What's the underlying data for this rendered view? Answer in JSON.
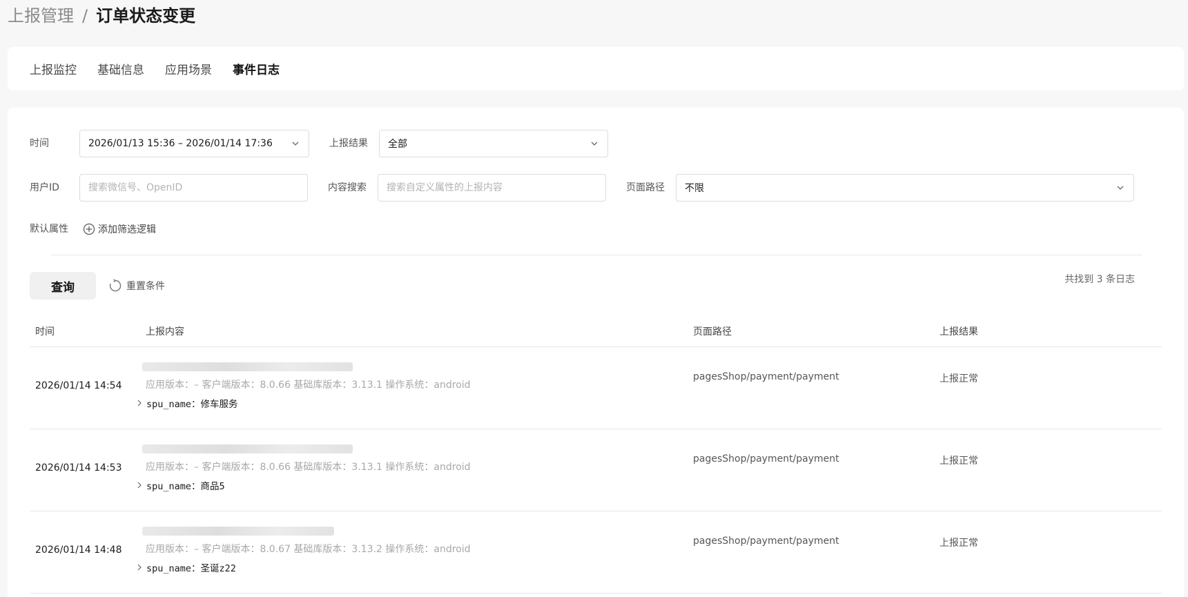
{
  "breadcrumb": {
    "parent": "上报管理",
    "separator": "/",
    "current": "订单状态变更"
  },
  "tabs": [
    {
      "label": "上报监控",
      "active": false
    },
    {
      "label": "基础信息",
      "active": false
    },
    {
      "label": "应用场景",
      "active": false
    },
    {
      "label": "事件日志",
      "active": true
    }
  ],
  "filters": {
    "time": {
      "label": "时间",
      "value": "2026/01/13 15:36 – 2026/01/14 17:36"
    },
    "result": {
      "label": "上报结果",
      "value": "全部"
    },
    "user_id": {
      "label": "用户ID",
      "placeholder": "搜索微信号、OpenID"
    },
    "content": {
      "label": "内容搜索",
      "placeholder": "搜索自定义属性的上报内容"
    },
    "page_path": {
      "label": "页面路径",
      "value": "不限"
    },
    "default_attr": {
      "label": "默认属性"
    },
    "add_filter": "添加筛选逻辑"
  },
  "actions": {
    "query": "查询",
    "reset": "重置条件",
    "count": "共找到 3 条日志"
  },
  "table": {
    "headers": {
      "time": "时间",
      "content": "上报内容",
      "path": "页面路径",
      "result": "上报结果"
    },
    "rows": [
      {
        "time": "2026/01/14 14:54",
        "meta": "应用版本：– 客户端版本：8.0.66 基础库版本：3.13.1 操作系统：android",
        "prop": "spu_name：修车服务",
        "path": "pagesShop/payment/payment",
        "result": "上报正常"
      },
      {
        "time": "2026/01/14 14:53",
        "meta": "应用版本：– 客户端版本：8.0.66 基础库版本：3.13.1 操作系统：android",
        "prop": "spu_name：商品5",
        "path": "pagesShop/payment/payment",
        "result": "上报正常"
      },
      {
        "time": "2026/01/14 14:48",
        "meta": "应用版本：– 客户端版本：8.0.67 基础库版本：3.13.2 操作系统：android",
        "prop": "spu_name：圣诞z22",
        "path": "pagesShop/payment/payment",
        "result": "上报正常"
      }
    ]
  },
  "icons": {
    "chevron": "chevron-down-icon",
    "add": "plus-circle-icon",
    "reset": "refresh-icon",
    "expand": "chevron-right-icon"
  }
}
